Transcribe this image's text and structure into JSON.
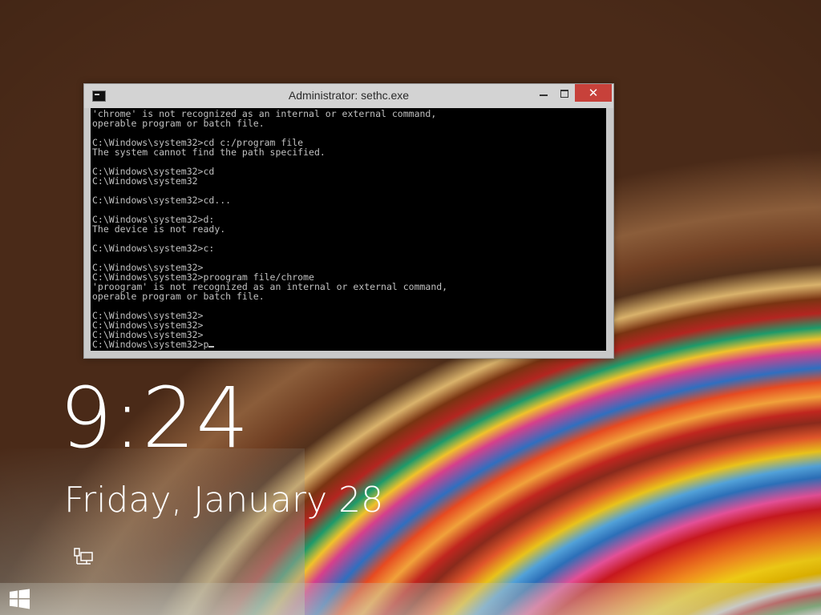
{
  "console": {
    "title": "Administrator: sethc.exe",
    "close_label": "✕",
    "lines": [
      "'chrome' is not recognized as an internal or external command,",
      "operable program or batch file.",
      "",
      "C:\\Windows\\system32>cd c:/program file",
      "The system cannot find the path specified.",
      "",
      "C:\\Windows\\system32>cd",
      "C:\\Windows\\system32",
      "",
      "C:\\Windows\\system32>cd...",
      "",
      "C:\\Windows\\system32>d:",
      "The device is not ready.",
      "",
      "C:\\Windows\\system32>c:",
      "",
      "C:\\Windows\\system32>",
      "C:\\Windows\\system32>proogram file/chrome",
      "'proogram' is not recognized as an internal or external command,",
      "operable program or batch file.",
      "",
      "C:\\Windows\\system32>",
      "C:\\Windows\\system32>",
      "C:\\Windows\\system32>"
    ],
    "current_prompt": "C:\\Windows\\system32>p"
  },
  "lockscreen": {
    "time": "9:24",
    "date": "Friday, January 28"
  },
  "icons": {
    "network": "network-icon",
    "windows": "windows-logo-icon",
    "console": "console-app-icon"
  },
  "colors": {
    "close_button": "#c7413a",
    "terminal_bg": "#000000",
    "terminal_fg": "#c0c0c0"
  }
}
